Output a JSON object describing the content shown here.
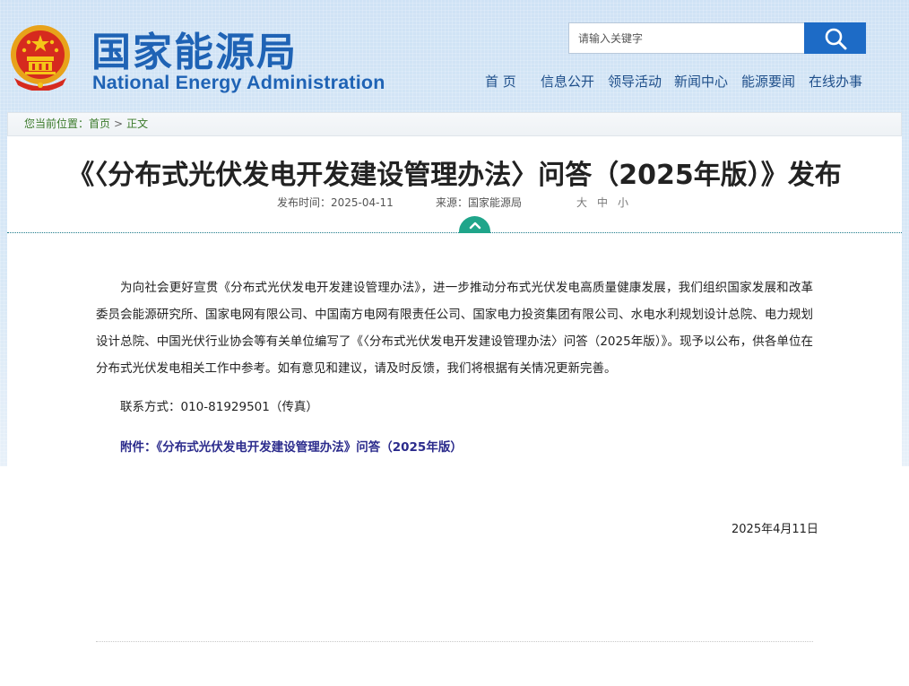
{
  "header": {
    "site_name_cn": "国家能源局",
    "site_name_en": "National Energy Administration",
    "search": {
      "placeholder": "请输入关键字"
    },
    "search_icon": "magnifier-icon",
    "nav": [
      "首 页",
      "信息公开",
      "领导活动",
      "新闻中心",
      "能源要闻",
      "在线办事"
    ]
  },
  "breadcrumb": {
    "prefix": "您当前位置：",
    "home": "首页",
    "separator": ">",
    "current": "正文"
  },
  "article": {
    "title": "《〈分布式光伏发电开发建设管理办法〉问答（2025年版）》发布",
    "publish_label": "发布时间：",
    "publish_date": "2025-04-11",
    "source_label": "来源：",
    "source": "国家能源局",
    "font_sizes": [
      "大",
      "中",
      "小"
    ],
    "collapse_icon": "chevron-up-icon",
    "paragraph": "为向社会更好宣贯《分布式光伏发电开发建设管理办法》，进一步推动分布式光伏发电高质量健康发展，我们组织国家发展和改革委员会能源研究所、国家电网有限公司、中国南方电网有限责任公司、国家电力投资集团有限公司、水电水利规划设计总院、电力规划设计总院、中国光伏行业协会等有关单位编写了《〈分布式光伏发电开发建设管理办法〉问答（2025年版）》。现予以公布，供各单位在分布式光伏发电相关工作中参考。如有意见和建议，请及时反馈，我们将根据有关情况更新完善。",
    "contact": "联系方式：010-81929501（传真）",
    "attachment": "附件：《分布式光伏发电开发建设管理办法》问答（2025年版）",
    "sign_date": "2025年4月11日"
  },
  "colors": {
    "brand_blue": "#1f63b5",
    "search_button": "#1d6bc6",
    "breadcrumb_green": "#3a7a2a",
    "collapse_tab": "#1fa58a",
    "attachment_link": "#2b2b8c"
  }
}
